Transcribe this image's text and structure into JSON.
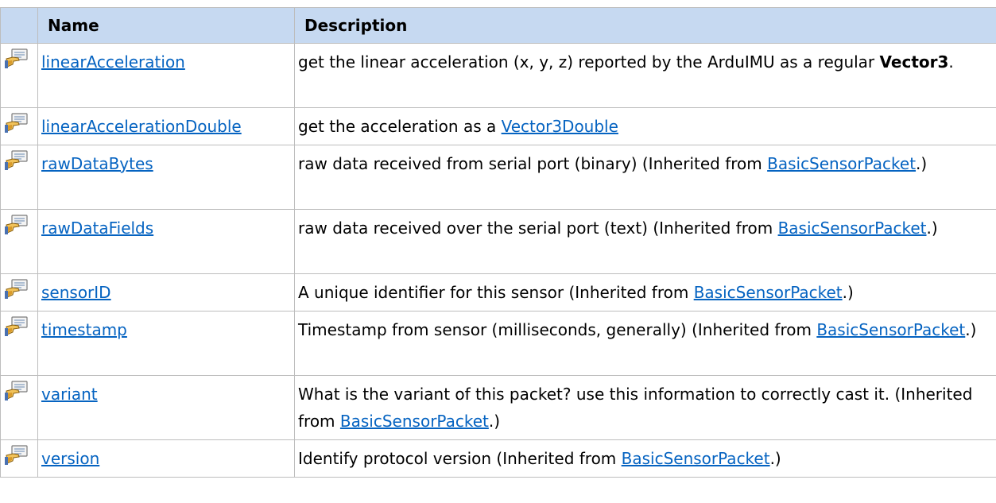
{
  "header": {
    "icon": "",
    "name": "Name",
    "description": "Description"
  },
  "rows": [
    {
      "icon": "property-icon",
      "name": "linearAcceleration",
      "desc_pre": "get the linear acceleration (x, y, z) reported by the ArduIMU as a regular ",
      "desc_bold": "Vector3",
      "desc_post": "."
    },
    {
      "icon": "property-icon",
      "name": "linearAccelerationDouble",
      "desc_pre": "get the acceleration as a ",
      "desc_link": "Vector3Double"
    },
    {
      "icon": "property-icon",
      "name": "rawDataBytes",
      "desc_pre": "raw data received from serial port (binary) (Inherited from ",
      "desc_link": "BasicSensorPacket",
      "desc_post": ".)"
    },
    {
      "icon": "property-icon",
      "name": "rawDataFields",
      "desc_pre": "raw data received over the serial port (text) (Inherited from ",
      "desc_link": "BasicSensorPacket",
      "desc_post": ".)"
    },
    {
      "icon": "property-icon",
      "name": "sensorID",
      "desc_pre": "A unique identifier for this sensor (Inherited from ",
      "desc_link": "BasicSensorPacket",
      "desc_post": ".)"
    },
    {
      "icon": "property-icon",
      "name": "timestamp",
      "desc_pre": "Timestamp from sensor (milliseconds, generally) (Inherited from ",
      "desc_link": "BasicSensorPacket",
      "desc_post": ".)"
    },
    {
      "icon": "property-icon",
      "name": "variant",
      "desc_pre": "What is the variant of this packet? use this information to correctly cast it. (Inherited from ",
      "desc_link": "BasicSensorPacket",
      "desc_post": ".)"
    },
    {
      "icon": "property-icon",
      "name": "version",
      "desc_pre": "Identify protocol version (Inherited from ",
      "desc_link": "BasicSensorPacket",
      "desc_post": ".)"
    }
  ],
  "colors": {
    "header_bg": "#c6d9f1",
    "link": "#0563c1",
    "border": "#bdbdbd"
  }
}
